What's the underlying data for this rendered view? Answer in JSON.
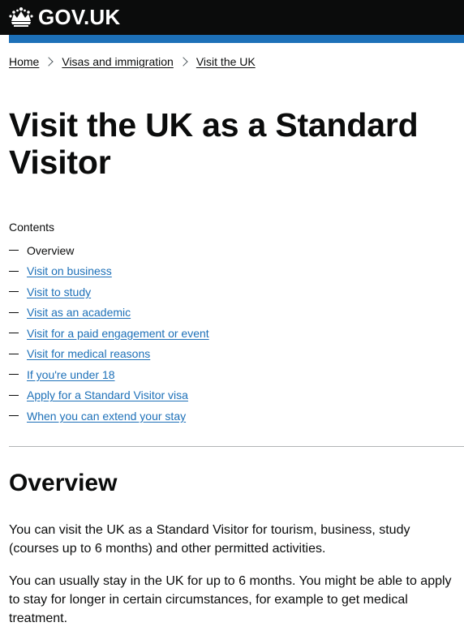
{
  "header": {
    "logo_text": "GOV.UK",
    "background_color": "#0b0c0c",
    "accent_bar_color": "#1d70b8",
    "logo_icon": "crown-icon"
  },
  "breadcrumbs": [
    {
      "label": "Home"
    },
    {
      "label": "Visas and immigration"
    },
    {
      "label": "Visit the UK"
    }
  ],
  "page": {
    "title": "Visit the UK as a Standard Visitor"
  },
  "contents": {
    "heading": "Contents",
    "items": [
      {
        "label": "Overview",
        "current": true
      },
      {
        "label": "Visit on business",
        "current": false
      },
      {
        "label": "Visit to study",
        "current": false
      },
      {
        "label": "Visit as an academic",
        "current": false
      },
      {
        "label": "Visit for a paid engagement or event",
        "current": false
      },
      {
        "label": "Visit for medical reasons",
        "current": false
      },
      {
        "label": "If you're under 18",
        "current": false
      },
      {
        "label": "Apply for a Standard Visitor visa",
        "current": false
      },
      {
        "label": "When you can extend your stay",
        "current": false
      }
    ],
    "link_color": "#1d70b8"
  },
  "section": {
    "heading": "Overview",
    "paragraphs": [
      "You can visit the UK as a Standard Visitor for tourism, business, study (courses up to 6 months) and other permitted activities.",
      "You can usually stay in the UK for up to 6 months. You might be able to apply to stay for longer in certain circumstances, for example to get medical treatment."
    ]
  }
}
